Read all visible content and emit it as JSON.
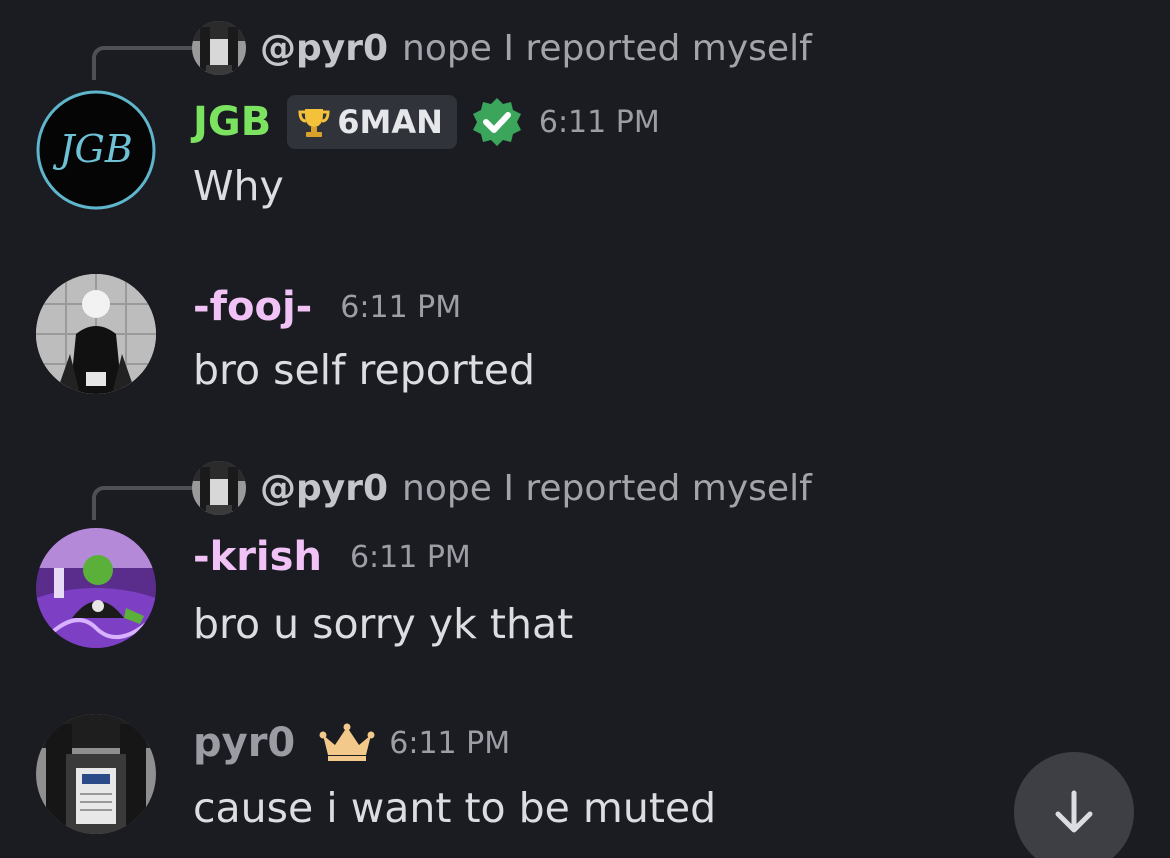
{
  "colors": {
    "background": "#1b1c21",
    "jgb_name": "#7be35f",
    "pink_name": "#f0c2f5",
    "pyr0_name": "#9a9ba3",
    "timestamp": "#9c9ea6",
    "verified_badge": "#3ba55c",
    "crown": "#f2c98a"
  },
  "messages": [
    {
      "reply": {
        "author": "@pyr0",
        "text": "nope I reported myself"
      },
      "author": "JGB",
      "avatar_text": "JGB",
      "role_tag": {
        "icon": "trophy-icon",
        "label": "6MAN"
      },
      "verified": true,
      "timestamp": "6:11 PM",
      "text": "Why"
    },
    {
      "author": "-fooj-",
      "timestamp": "6:11 PM",
      "text": "bro self reported"
    },
    {
      "reply": {
        "author": "@pyr0",
        "text": "nope I reported myself"
      },
      "author": "-krish",
      "timestamp": "6:11 PM",
      "text": "bro u sorry yk that"
    },
    {
      "author": "pyr0",
      "owner_icon": "crown-icon",
      "timestamp": "6:11 PM",
      "text": "cause i want to be muted"
    }
  ],
  "scroll_button_icon": "arrow-down-icon"
}
